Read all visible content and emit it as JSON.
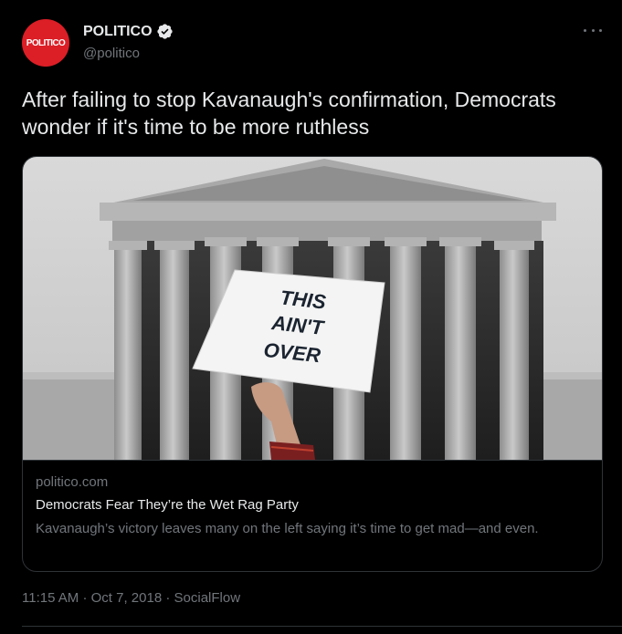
{
  "account": {
    "avatar_text": "POLITICO",
    "name": "POLITICO",
    "handle": "@politico",
    "verified_icon": "verified-badge-icon",
    "more_icon": "more-options-icon"
  },
  "tweet": {
    "text": "After failing to stop Kavanaugh's confirmation, Democrats wonder if it's time to be more ruthless"
  },
  "card": {
    "image_sign_lines": [
      "THIS",
      "AIN'T",
      "OVER"
    ],
    "domain": "politico.com",
    "title": "Democrats Fear They’re the Wet Rag Party",
    "description": "Kavanaugh’s victory leaves many on the left saying it’s time to get mad—and even."
  },
  "meta": {
    "time": "11:15 AM",
    "separator": "·",
    "date": "Oct 7, 2018",
    "source": "SocialFlow"
  },
  "colors": {
    "background": "#000000",
    "brand_red": "#dc1e26",
    "text_primary": "#e7e9ea",
    "text_secondary": "#71767b",
    "border": "#2f3336"
  }
}
